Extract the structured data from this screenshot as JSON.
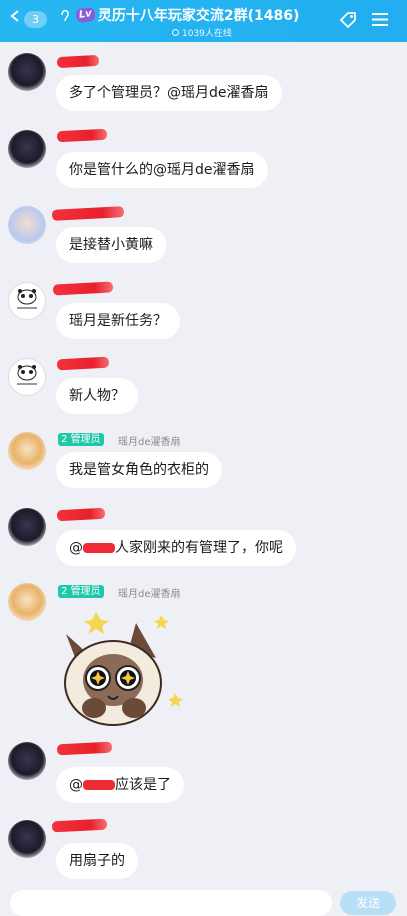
{
  "header": {
    "back_badge": "3",
    "level_badge": "Lv",
    "group_title": "灵历十八年玩家交流2群(1486)",
    "online_text": "1039人在线"
  },
  "messages": [
    {
      "text": "多了个管理员？@瑶月de濯香扇",
      "avatar": "dark"
    },
    {
      "text": "你是管什么的@瑶月de濯香扇",
      "avatar": "dark"
    },
    {
      "text": "是接替小黄嘛",
      "avatar": "blue"
    },
    {
      "text": "瑶月是新任务？",
      "avatar": "panda"
    },
    {
      "text": "新人物？",
      "avatar": "panda"
    },
    {
      "text": "我是管女角色的衣柜的",
      "avatar": "gold",
      "admin_label": "管理员",
      "admin_level": "2",
      "sender": "瑶月de濯香扇"
    },
    {
      "text_before": "@",
      "text_after": "人家刚来的有管理了，你呢",
      "avatar": "dark"
    },
    {
      "sticker": "cat-sticker",
      "avatar": "gold",
      "admin_label": "管理员",
      "admin_level": "2",
      "sender": "瑶月de濯香扇"
    },
    {
      "text_before": "@",
      "text_after": "应该是了",
      "avatar": "dark"
    },
    {
      "text": "用扇子的",
      "avatar": "dark"
    }
  ],
  "input": {
    "send_label": "发送"
  },
  "colors": {
    "header": "#22aef0",
    "admin_tag": "#1fc8a8",
    "redaction": "#ee2b34"
  }
}
